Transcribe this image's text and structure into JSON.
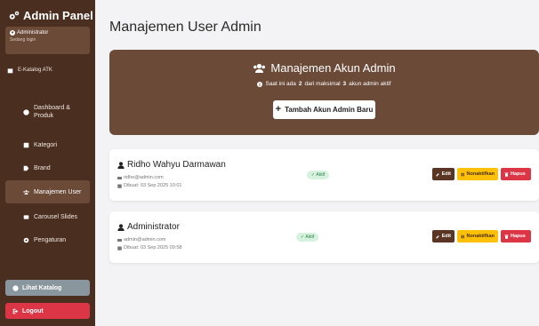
{
  "sidebar": {
    "brand": "Admin Panel",
    "user": {
      "name": "Administrator",
      "status": "Sedang login"
    },
    "nav": {
      "catalog_atk": "E-Katalog ATK",
      "dashboard": "Dashboard & Produk",
      "kategori": "Kategori",
      "brand": "Brand",
      "users": "Manajemen User",
      "carousel": "Carousel Slides",
      "settings": "Pengaturan"
    },
    "view_catalog": "Lihat Katalog",
    "logout": "Logout"
  },
  "main": {
    "title": "Manajemen User Admin",
    "hero": {
      "title": "Manajemen Akun Admin",
      "sub_prefix": "Saat ini ada",
      "sub_count": "2",
      "sub_mid": "dari maksimal",
      "sub_max": "3",
      "sub_suffix": "akun admin aktif",
      "add_button": "Tambah Akun Admin Baru"
    },
    "users": [
      {
        "name": "Ridho Wahyu Darmawan",
        "email": "ridho@admin.com",
        "created": "Dibuat: 03 Sep 2025 10:01",
        "status": "Aktif"
      },
      {
        "name": "Administrator",
        "email": "admin@admin.com",
        "created": "Dibuat: 03 Sep 2025 09:58",
        "status": "Aktif"
      }
    ],
    "actions": {
      "edit": "Edit",
      "deactivate": "Nonaktifkan",
      "delete": "Hapus"
    }
  },
  "colors": {
    "sidebar": "#4a2e1f",
    "accent": "#6b4a38",
    "warning": "#ffc107",
    "danger": "#dc3545",
    "success_bg": "#d6f2de"
  }
}
